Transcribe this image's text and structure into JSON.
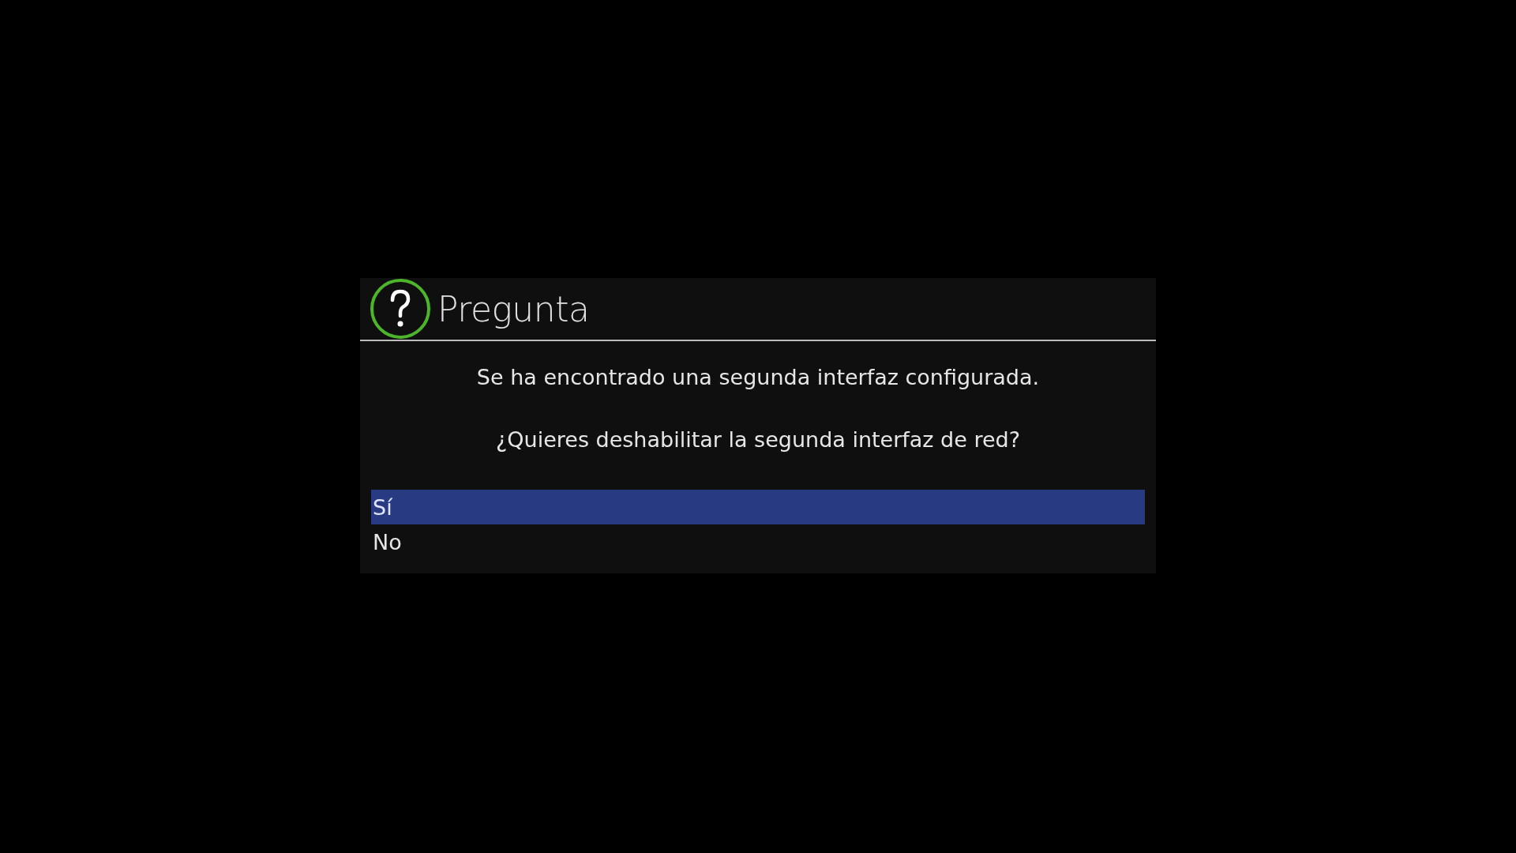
{
  "dialog": {
    "title": "Pregunta",
    "messages": [
      "Se ha encontrado una segunda interfaz configurada.",
      "¿Quieres deshabilitar la segunda interfaz de red?"
    ],
    "options": [
      {
        "label": "Sí",
        "selected": true
      },
      {
        "label": "No",
        "selected": false
      }
    ]
  }
}
